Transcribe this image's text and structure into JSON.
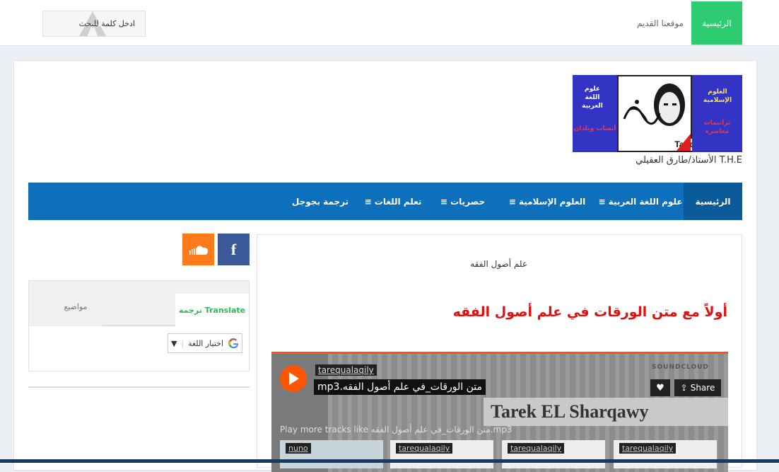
{
  "topbar": {
    "nav_home": "الرئيسية",
    "nav_old_site": "موقعنا القديم",
    "search_placeholder": "ادخل كلمة للبحث"
  },
  "logo": {
    "right_title": "العلوم الإسلامية",
    "right_sub": "ترانيمات معاصرة",
    "left_title": "علوم اللغة العربية",
    "left_sub": "أنساب وبلدان",
    "caption": "Tariq alaqily"
  },
  "tagline": "الأستاذ/طارق العقيلي T.H.E",
  "main_nav": [
    {
      "label": "الرئيسية"
    },
    {
      "label": "علوم اللغة العربية"
    },
    {
      "label": "العلوم الإسلامية"
    },
    {
      "label": "حصريات"
    },
    {
      "label": "تعلم اللغات"
    },
    {
      "label": "ترجمة بجوجل"
    }
  ],
  "post": {
    "category": "علم أصول الفقه",
    "title": "أولاً مع متن الورقات في علم أصول الفقه"
  },
  "player": {
    "user": "tarequalaqily",
    "track": "متن الورقات_في علم أصول الفقه.mp3",
    "share_label": "Share",
    "band_text": "Tarek EL Sharqawy",
    "brand": "SOUNDCLOUD",
    "more_text": "Play more tracks like متن الورقات_في علم أصول الفقه.mp3",
    "thumbs": [
      "nuno",
      "tarequalaqily",
      "tarequalaqily",
      "tarequalaqily"
    ]
  },
  "sidebar": {
    "tab_translate": "Translate ترجمة",
    "tab_topics": "مواضيع",
    "language_select": "اختيار اللغة"
  },
  "colors": {
    "green": "#2ecc71",
    "nav_blue": "#0e6fbb",
    "title_red": "#e01010",
    "soundcloud_orange": "#ff5500",
    "facebook_blue": "#3b5998"
  }
}
